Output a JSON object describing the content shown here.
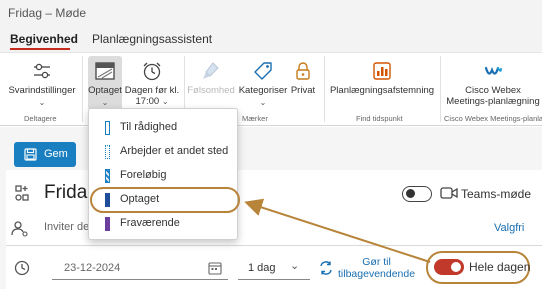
{
  "window": {
    "title": "Fridag – Møde"
  },
  "tabs": [
    {
      "label": "Begivenhed",
      "active": true
    },
    {
      "label": "Planlægningsassistent",
      "active": false
    }
  ],
  "ribbon": {
    "svarindstillinger": "Svarindstillinger",
    "optaget": "Optaget",
    "dagen_line1": "Dagen før kl.",
    "dagen_line2": "17:00",
    "folsomhed": "Følsomhed",
    "kategoriser": "Kategoriser",
    "privat": "Privat",
    "planlaegning": "Planlægningsafstemning",
    "webex_line1": "Cisco Webex",
    "webex_line2": "Meetings-planlægning",
    "groups": {
      "deltagere": "Deltagere",
      "maerker": "Mærker",
      "find_tidspunkt": "Find tidspunkt",
      "webex": "Cisco Webex Meetings-planlægning"
    }
  },
  "toolbar": {
    "save_label": "Gem"
  },
  "event": {
    "title": "Fridag",
    "teams_label": "Teams-møde",
    "invite_placeholder": "Inviter de",
    "valgfri": "Valgfri",
    "date": "23-12-2024",
    "duration": "1 dag",
    "recurring_line1": "Gør til",
    "recurring_line2": "tilbagevendende",
    "allday_label": "Hele dagen",
    "allday_on": true
  },
  "show_as_menu": {
    "items": [
      {
        "label": "Til rådighed",
        "color": "#ffffff",
        "border": "#1a7fc1"
      },
      {
        "label": "Arbejder et andet sted",
        "color": "#ffffff",
        "border": "#1a7fc1",
        "dotted": true
      },
      {
        "label": "Foreløbig",
        "color": "#8fb3e0",
        "border": "#1a7fc1",
        "striped": true
      },
      {
        "label": "Optaget",
        "color": "#1e4e9c",
        "border": "#1e4e9c"
      },
      {
        "label": "Fraværende",
        "color": "#6a3fa0",
        "border": "#6a3fa0"
      }
    ],
    "selected": "Optaget"
  },
  "colors": {
    "accent": "#1a7fc1",
    "active_tab": "#c42b1c",
    "highlight": "#b7843a",
    "toggle_on": "#c0392b"
  }
}
